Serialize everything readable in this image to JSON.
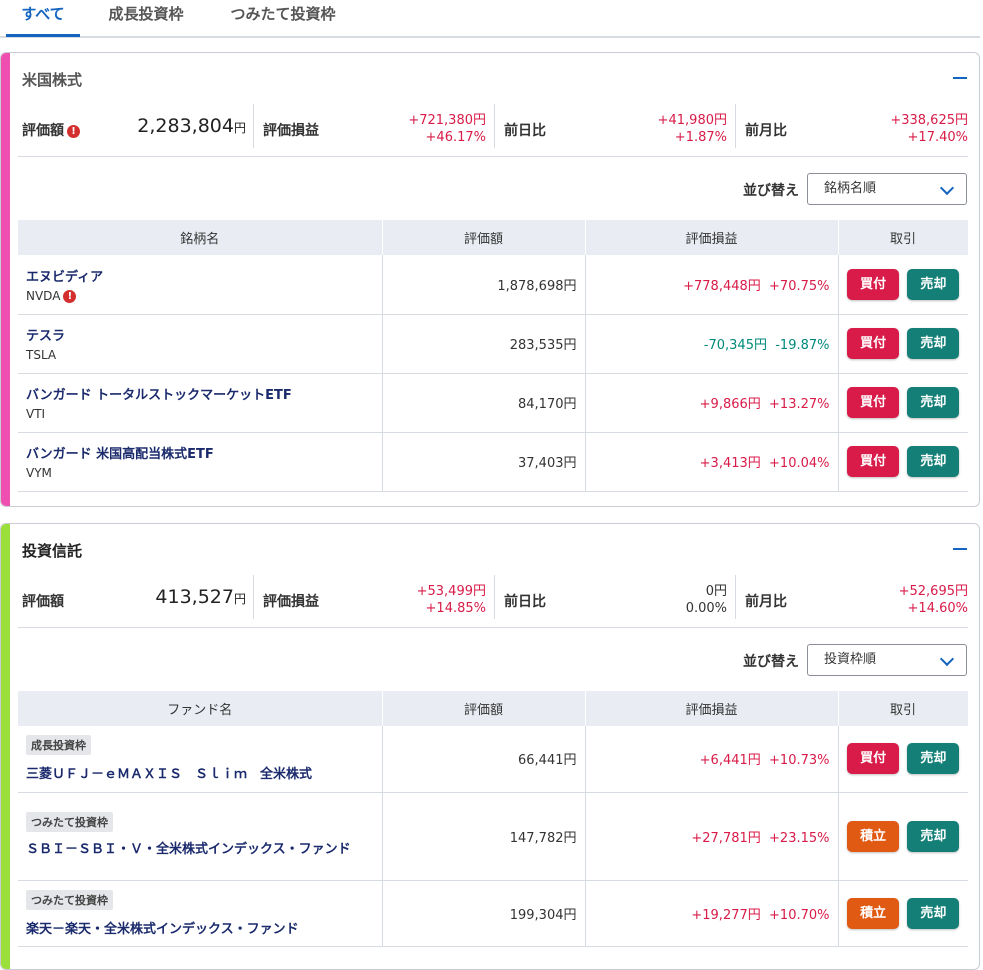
{
  "tabs": [
    "すべて",
    "成長投資枠",
    "つみたて投資枠"
  ],
  "colors": {
    "accent": "#1565c0",
    "us_bar": "#f04fb2",
    "fund_bar": "#9be03a",
    "positive": "#d81b48",
    "negative": "#00897b",
    "buy": "#d81b48",
    "sell": "#137f77",
    "tsumitate": "#e05a14"
  },
  "us": {
    "title": "米国株式",
    "summary": {
      "eval_label": "評価額",
      "eval_value": "2,283,804",
      "eval_unit": "円",
      "pl_label": "評価損益",
      "pl_yen": "+721,380円",
      "pl_pct": "+46.17%",
      "day_label": "前日比",
      "day_yen": "+41,980円",
      "day_pct": "+1.87%",
      "month_label": "前月比",
      "month_yen": "+338,625円",
      "month_pct": "+17.40%"
    },
    "sort_label": "並び替え",
    "sort_value": "銘柄名順",
    "headers": [
      "銘柄名",
      "評価額",
      "評価損益",
      "取引"
    ],
    "rows": [
      {
        "name": "エヌビディア",
        "ticker": "NVDA",
        "value": "1,878,698円",
        "pl_yen": "+778,448円",
        "pl_pct": "+70.75%",
        "buy": "買付",
        "sell": "売却"
      },
      {
        "name": "テスラ",
        "ticker": "TSLA",
        "value": "283,535円",
        "pl_yen": "-70,345円",
        "pl_pct": "-19.87%",
        "buy": "買付",
        "sell": "売却"
      },
      {
        "name": "バンガード トータルストックマーケットETF",
        "ticker": "VTI",
        "value": "84,170円",
        "pl_yen": "+9,866円",
        "pl_pct": "+13.27%",
        "buy": "買付",
        "sell": "売却"
      },
      {
        "name": "バンガード 米国高配当株式ETF",
        "ticker": "VYM",
        "value": "37,403円",
        "pl_yen": "+3,413円",
        "pl_pct": "+10.04%",
        "buy": "買付",
        "sell": "売却"
      }
    ]
  },
  "fund": {
    "title": "投資信託",
    "summary": {
      "eval_label": "評価額",
      "eval_value": "413,527",
      "eval_unit": "円",
      "pl_label": "評価損益",
      "pl_yen": "+53,499円",
      "pl_pct": "+14.85%",
      "day_label": "前日比",
      "day_yen": "0円",
      "day_pct": "0.00%",
      "month_label": "前月比",
      "month_yen": "+52,695円",
      "month_pct": "+14.60%"
    },
    "sort_label": "並び替え",
    "sort_value": "投資枠順",
    "headers": [
      "ファンド名",
      "評価額",
      "評価損益",
      "取引"
    ],
    "rows": [
      {
        "badge": "成長投資枠",
        "name": "三菱ＵＦＪ－ｅＭＡＸＩＳ　Ｓｌｉｍ　全米株式",
        "value": "66,441円",
        "pl_yen": "+6,441円",
        "pl_pct": "+10.73%",
        "buy": "買付",
        "sell": "売却"
      },
      {
        "badge": "つみたて投資枠",
        "name": "ＳＢＩ－ＳＢＩ・Ｖ・全米株式インデックス・ファンド",
        "value": "147,782円",
        "pl_yen": "+27,781円",
        "pl_pct": "+23.15%",
        "buy": "積立",
        "sell": "売却"
      },
      {
        "badge": "つみたて投資枠",
        "name": "楽天－楽天・全米株式インデックス・ファンド",
        "value": "199,304円",
        "pl_yen": "+19,277円",
        "pl_pct": "+10.70%",
        "buy": "積立",
        "sell": "売却"
      }
    ]
  }
}
